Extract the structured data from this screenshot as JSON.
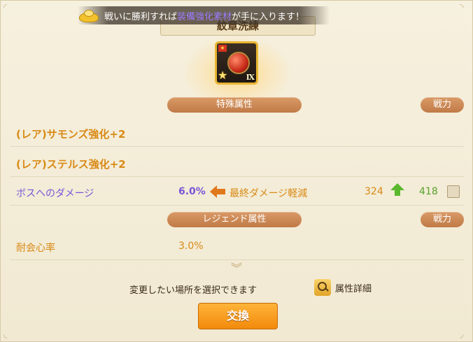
{
  "banner": {
    "prefix": "戦いに勝利すれば",
    "highlight": "装備強化素材",
    "suffix": "が手に入ります！"
  },
  "title": "紋章洗練",
  "emblem": {
    "rank": "Ⅸ"
  },
  "special": {
    "header": "特殊属性",
    "power_button": "戦力",
    "items": [
      {
        "text": "(レア)サモンズ強化+2"
      },
      {
        "text": "(レア)ステルス強化+2"
      }
    ],
    "compare": {
      "label": "ボスへのダメージ",
      "value": "6.0%",
      "new_label": "最終ダメージ軽減",
      "new_power": "324",
      "current_power": "418"
    }
  },
  "legend": {
    "header": "レジェンド属性",
    "power_button": "戦力",
    "items": [
      {
        "label": "耐会心率",
        "value": "3.0%"
      }
    ]
  },
  "footer": {
    "hint": "変更したい場所を選択できます",
    "detail": "属性詳細",
    "exchange": "交換"
  },
  "colors": {
    "accent_orange": "#d98a16",
    "purple": "#7b55d8",
    "green": "#58a12c",
    "pill": "#c98856",
    "button": "#f59a1c"
  },
  "icons": [
    "gold-ingot-icon",
    "emblem-icon",
    "star-icon",
    "arrow-left-icon",
    "arrow-up-icon",
    "chevron-down-icon",
    "magnifier-icon"
  ]
}
